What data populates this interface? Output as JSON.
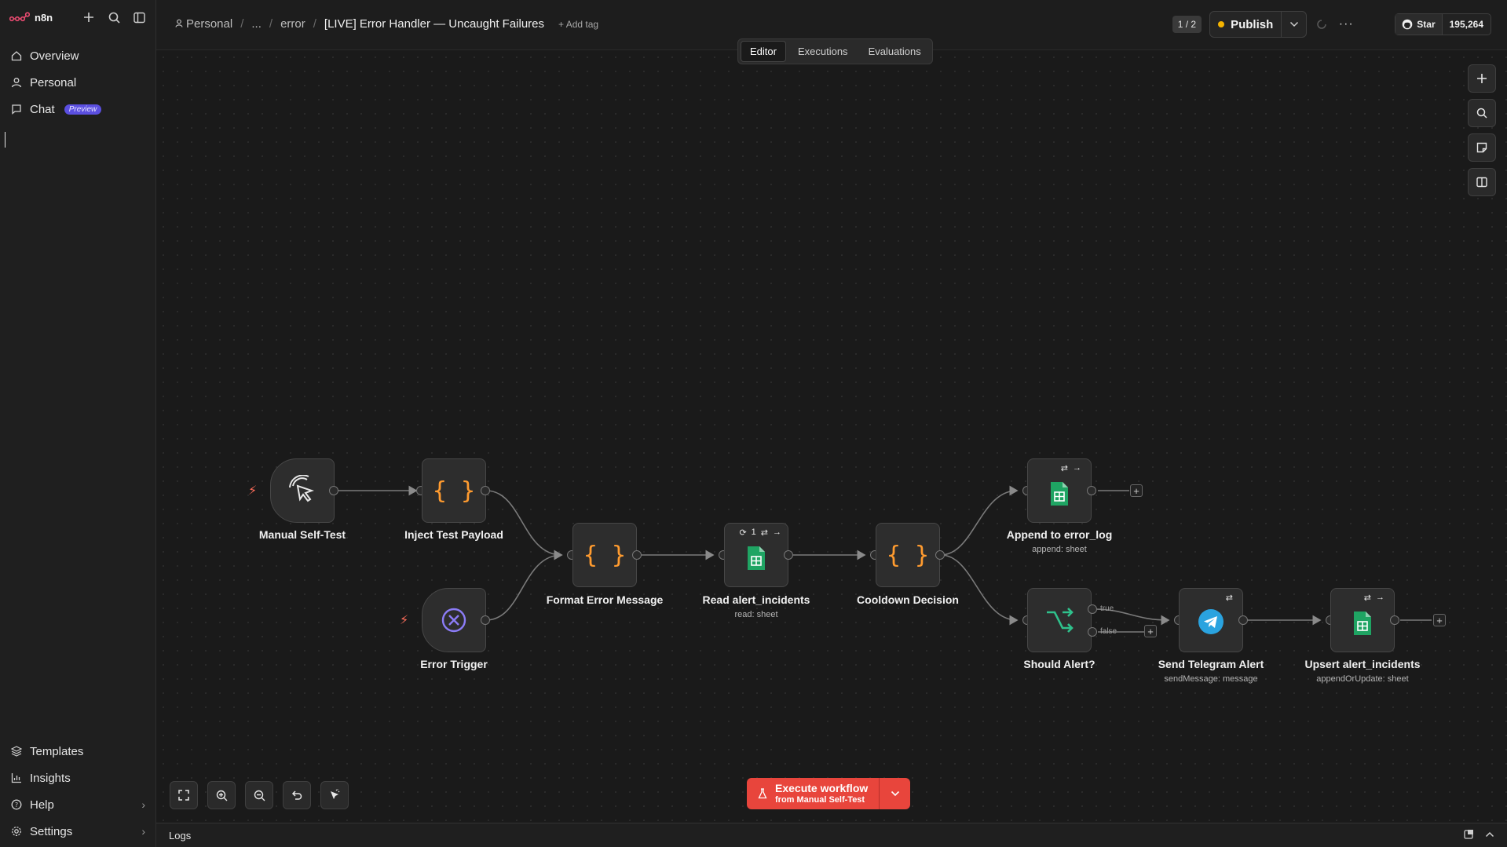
{
  "app": {
    "logo": "n8n"
  },
  "sidebar": {
    "items": [
      {
        "label": "Overview",
        "icon": "home-icon"
      },
      {
        "label": "Personal",
        "icon": "user-icon"
      },
      {
        "label": "Chat",
        "icon": "chat-icon",
        "badge": "Preview"
      }
    ],
    "bottom": [
      {
        "label": "Templates",
        "icon": "templates-icon"
      },
      {
        "label": "Insights",
        "icon": "chart-icon"
      },
      {
        "label": "Help",
        "icon": "help-icon"
      },
      {
        "label": "Settings",
        "icon": "gear-icon"
      }
    ]
  },
  "header": {
    "breadcrumb": [
      "Personal",
      "...",
      "error"
    ],
    "title": "[LIVE] Error Handler — Uncaught Failures",
    "add_tag": "+ Add tag",
    "tabs": [
      "Editor",
      "Executions",
      "Evaluations"
    ],
    "active_tab": "Editor",
    "pager": "1 / 2",
    "publish": "Publish",
    "github_star": "Star",
    "github_count": "195,264"
  },
  "nodes": {
    "manual": {
      "label": "Manual Self-Test"
    },
    "inject": {
      "label": "Inject Test Payload"
    },
    "error_trigger": {
      "label": "Error Trigger"
    },
    "format": {
      "label": "Format Error Message"
    },
    "read": {
      "label": "Read alert_incidents",
      "sub": "read: sheet",
      "badge": "1"
    },
    "cooldown": {
      "label": "Cooldown Decision"
    },
    "append": {
      "label": "Append to error_log",
      "sub": "append: sheet"
    },
    "should": {
      "label": "Should Alert?",
      "true_label": "true",
      "false_label": "false"
    },
    "telegram": {
      "label": "Send Telegram Alert",
      "sub": "sendMessage: message"
    },
    "upsert": {
      "label": "Upsert alert_incidents",
      "sub": "appendOrUpdate: sheet"
    }
  },
  "execute": {
    "line1": "Execute workflow",
    "line2": "from Manual Self-Test"
  },
  "logs": {
    "label": "Logs"
  },
  "colors": {
    "accent": "#e8453c",
    "sheets": "#1fa463",
    "telegram": "#2aa3df",
    "code": "#ff9b2f",
    "trigger": "#ff6d5a",
    "publish_dot": "#f5b400"
  }
}
